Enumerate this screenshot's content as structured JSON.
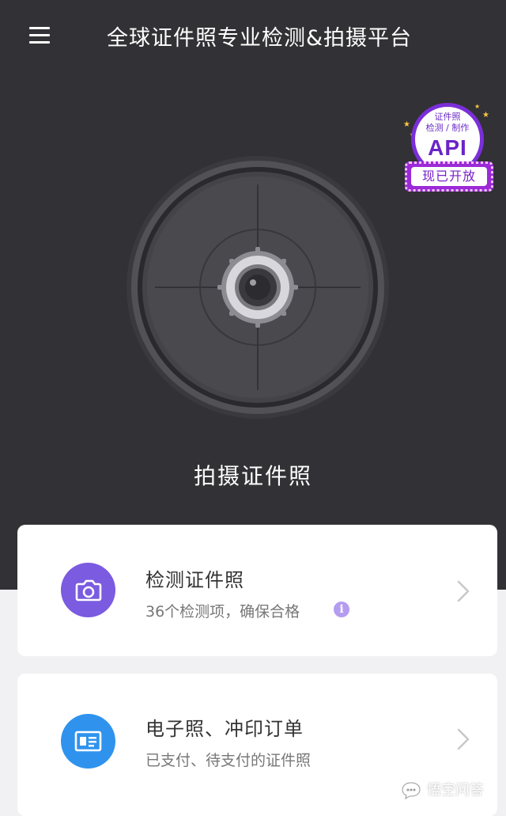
{
  "header": {
    "title": "全球证件照专业检测&拍摄平台",
    "menu_icon": "hamburger-menu-icon"
  },
  "hero": {
    "background": "#323135",
    "camera_icon": "camera-lens-icon",
    "shoot_label": "拍摄证件照"
  },
  "api_badge": {
    "line1": "证件照",
    "line2": "检测 / 制作",
    "big": "API",
    "ribbon": "现已开放",
    "accent": "#7a2fd8"
  },
  "cards": [
    {
      "title": "检测证件照",
      "subtitle": "36个检测项，确保合格",
      "icon": "camera-icon",
      "icon_color": "#7b5be0",
      "info_icon": "i"
    },
    {
      "title": "电子照、冲印订单",
      "subtitle": "已支付、待支付的证件照",
      "icon": "id-card-icon",
      "icon_color": "#2f93ee"
    }
  ],
  "watermark": {
    "text": "悟空问答"
  }
}
